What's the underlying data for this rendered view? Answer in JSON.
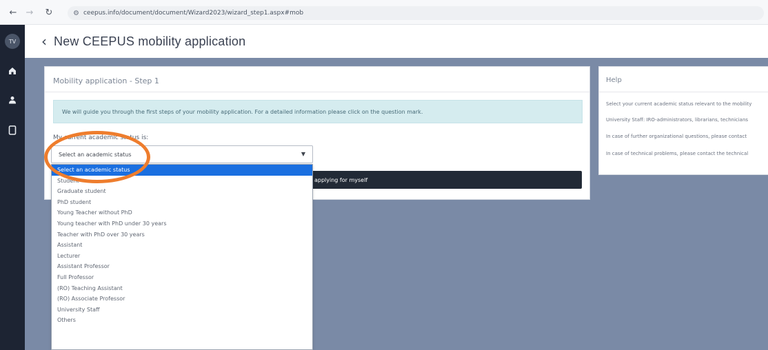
{
  "browser": {
    "url": "ceepus.info/document/document/Wizard2023/wizard_step1.aspx#mob"
  },
  "rail": {
    "avatar_initials": "TV"
  },
  "header": {
    "title": "New CEEPUS mobility application"
  },
  "step_card": {
    "title": "Mobility application - Step 1",
    "info": "We will guide you through the first steps of your mobility application. For a detailed information please click on the question mark.",
    "field_label": "My current academic status is:",
    "select_value": "Select an academic status",
    "apply_button": "applying for myself"
  },
  "help_card": {
    "title": "Help",
    "lines": [
      "Select your current academic status relevant to the mobility",
      "University Staff: IRO-administrators, librarians, technicians",
      "In case of further organizational questions, please contact",
      "In case of technical problems, please contact the technical"
    ]
  },
  "dropdown": {
    "options": [
      "Select an academic status",
      "Student",
      "Graduate student",
      "PhD student",
      "Young Teacher without PhD",
      "Young teacher with PhD under 30 years",
      "Teacher with PhD over 30 years",
      "Assistant",
      "Lecturer",
      "Assistant Professor",
      "Full Professor",
      "(RO) Teaching Assistant",
      "(RO) Associate Professor",
      "University Staff",
      "Others"
    ]
  },
  "colors": {
    "accent": "#1a6fe0",
    "highlight": "#ee7d2d",
    "rail": "#1d2433",
    "main_bg": "#7a8aa6"
  }
}
